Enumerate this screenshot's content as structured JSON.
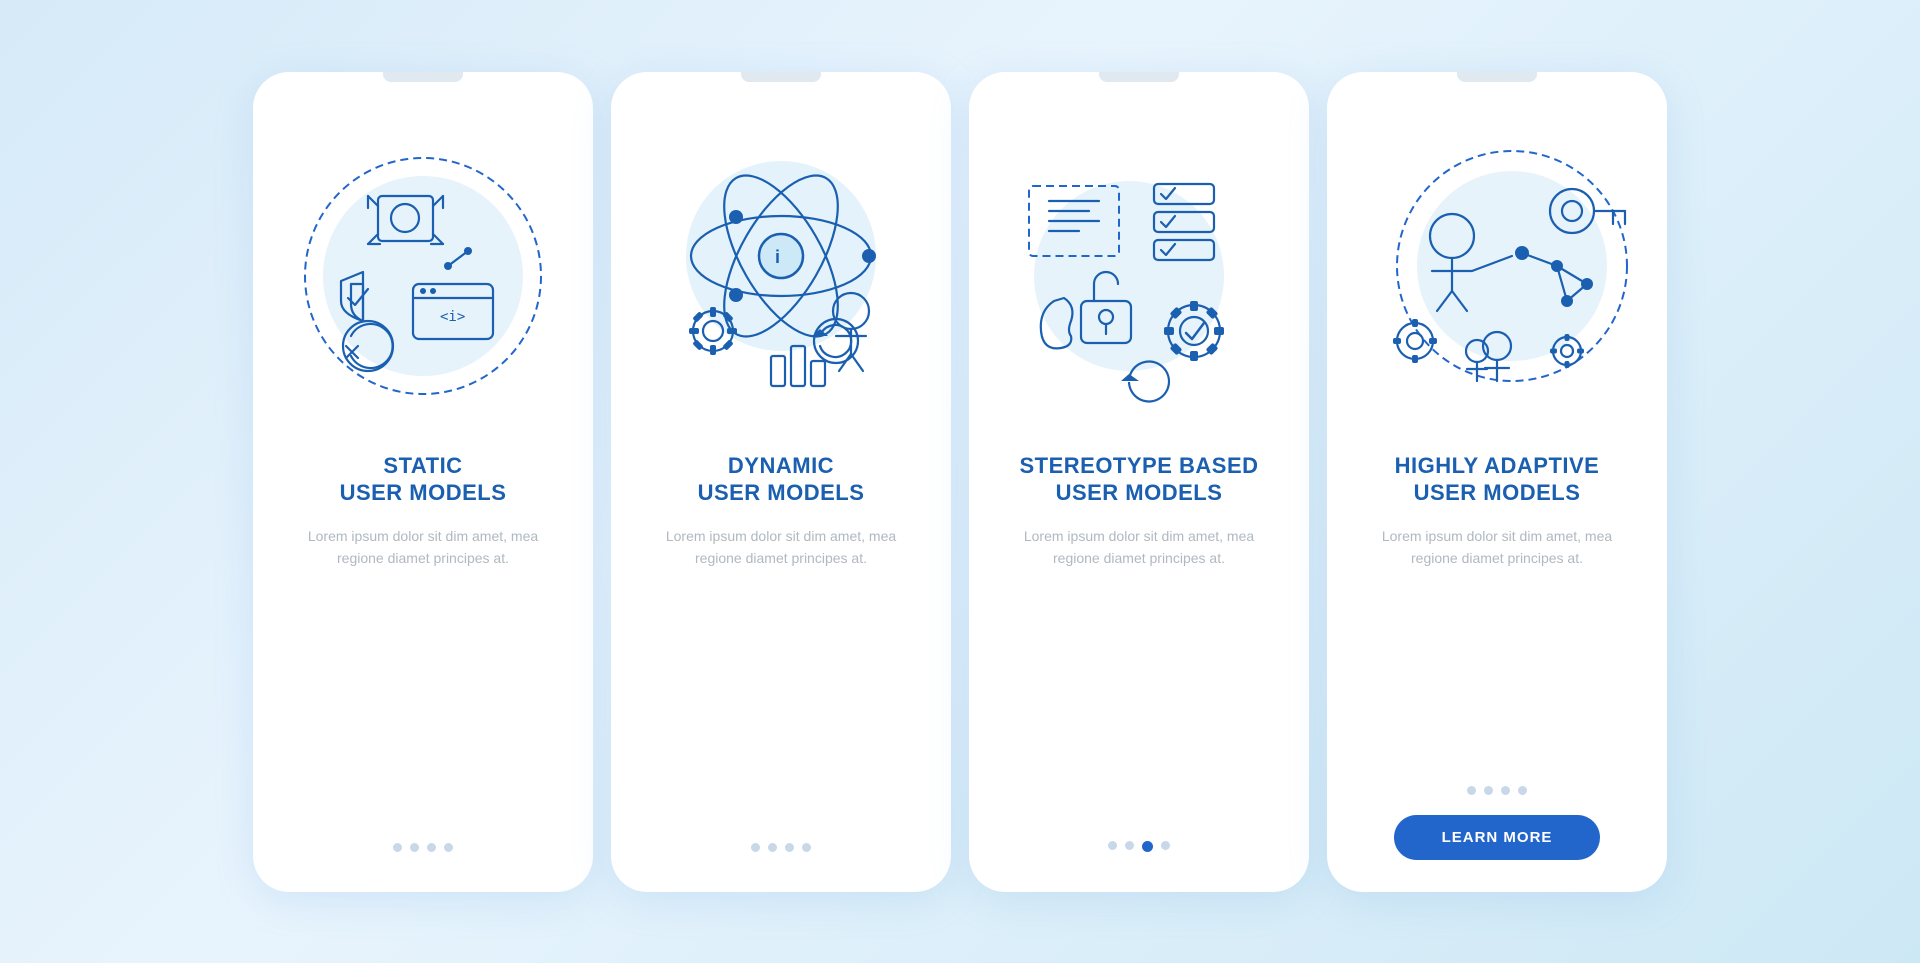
{
  "page": {
    "background": "#d6eaf8"
  },
  "cards": [
    {
      "id": "static",
      "title": "STATIC\nUSER MODELS",
      "description": "Lorem ipsum dolor sit dim amet, mea regione diamet principes at.",
      "dots": [
        {
          "active": false
        },
        {
          "active": false
        },
        {
          "active": false
        },
        {
          "active": false
        }
      ],
      "has_button": false,
      "button_label": null
    },
    {
      "id": "dynamic",
      "title": "DYNAMIC\nUSER MODELS",
      "description": "Lorem ipsum dolor sit dim amet, mea regione diamet principes at.",
      "dots": [
        {
          "active": false
        },
        {
          "active": false
        },
        {
          "active": false
        },
        {
          "active": false
        }
      ],
      "has_button": false,
      "button_label": null
    },
    {
      "id": "stereotype",
      "title": "STEREOTYPE BASED\nUSER MODELS",
      "description": "Lorem ipsum dolor sit dim amet, mea regione diamet principes at.",
      "dots": [
        {
          "active": false
        },
        {
          "active": false
        },
        {
          "active": true
        },
        {
          "active": false
        }
      ],
      "has_button": false,
      "button_label": null
    },
    {
      "id": "highly-adaptive",
      "title": "HIGHLY ADAPTIVE\nUSER MODELS",
      "description": "Lorem ipsum dolor sit dim amet, mea regione diamet principes at.",
      "dots": [
        {
          "active": false
        },
        {
          "active": false
        },
        {
          "active": false
        },
        {
          "active": false
        }
      ],
      "has_button": true,
      "button_label": "LEARN MORE"
    }
  ]
}
